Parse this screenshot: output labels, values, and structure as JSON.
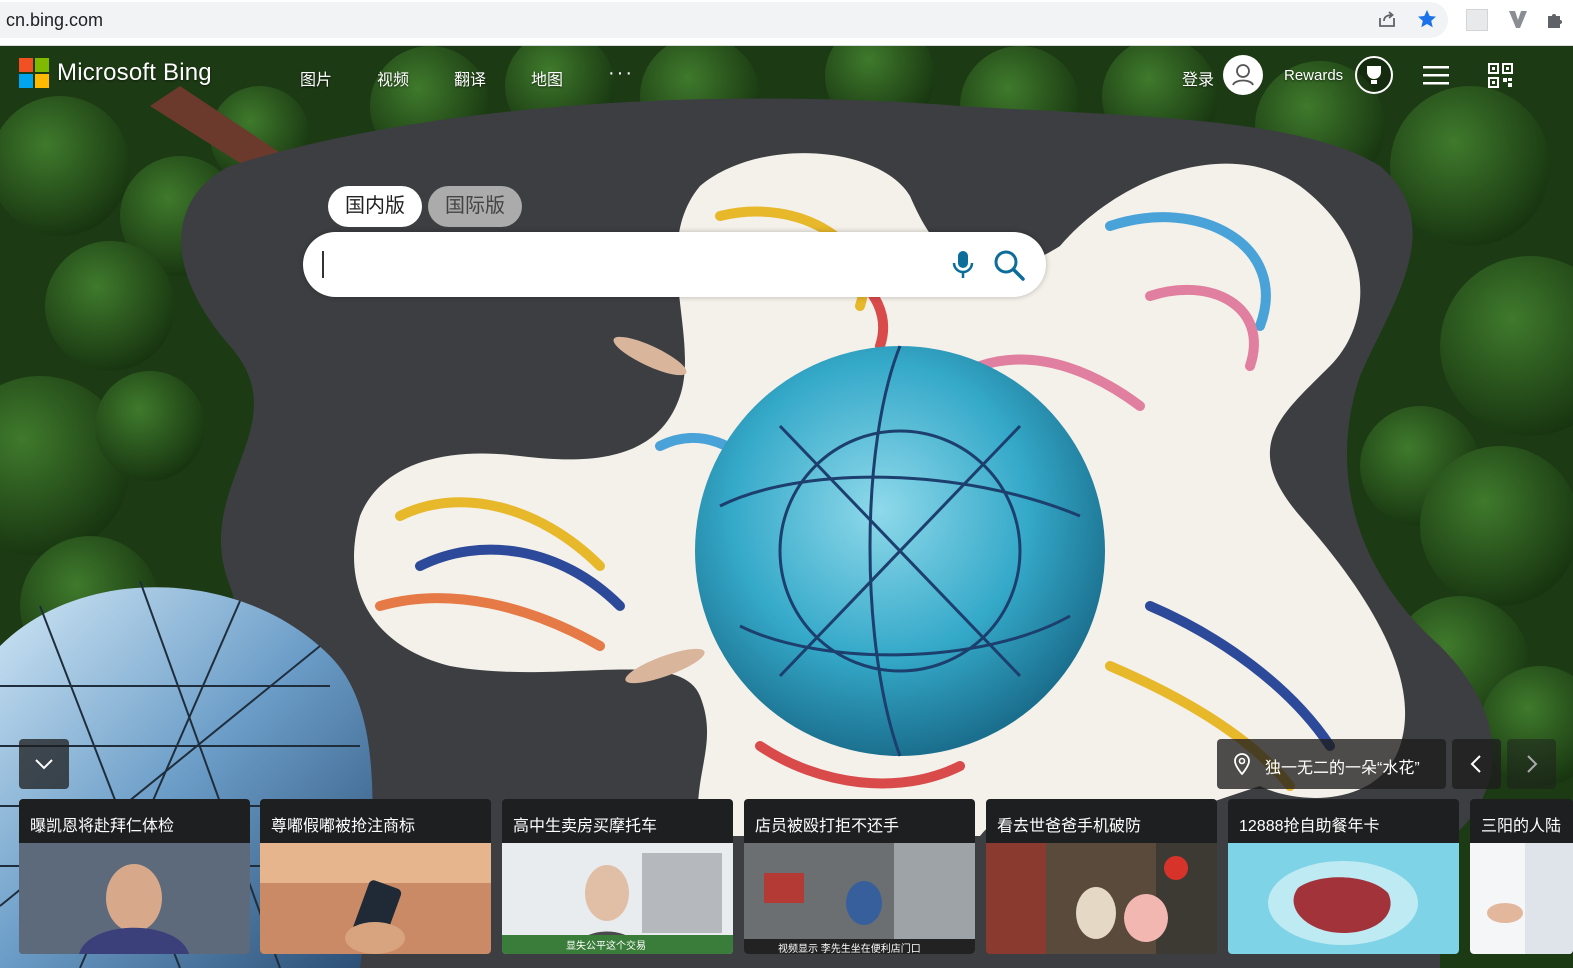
{
  "browser": {
    "url": "cn.bing.com",
    "icons": [
      "share-icon",
      "star-icon",
      "extension-icon",
      "extension-v-icon",
      "puzzle-icon"
    ]
  },
  "header": {
    "logo_text": "Microsoft Bing",
    "nav": [
      "图片",
      "视频",
      "翻译",
      "地图"
    ],
    "more": "···",
    "signin": "登录",
    "rewards": "Rewards"
  },
  "search": {
    "tabs": [
      "国内版",
      "国际版"
    ],
    "active_tab": "国内版",
    "value": "",
    "placeholder": ""
  },
  "image_info": {
    "title": "独一无二的一朵“水花”"
  },
  "news": [
    {
      "title": "曝凯恩将赴拜仁体检"
    },
    {
      "title": "尊嘟假嘟被抢注商标"
    },
    {
      "title": "高中生卖房买摩托车",
      "caption": "显失公平这个交易"
    },
    {
      "title": "店员被殴打拒不还手",
      "caption": "视频显示 李先生坐在便利店门口"
    },
    {
      "title": "看去世爸爸手机破防"
    },
    {
      "title": "12888抢自助餐年卡"
    },
    {
      "title": "三阳的人陆"
    }
  ],
  "colors": {
    "accent": "#1d6ed3",
    "search_icon": "#0c6d9a",
    "card_bg": "#1e1f20"
  }
}
